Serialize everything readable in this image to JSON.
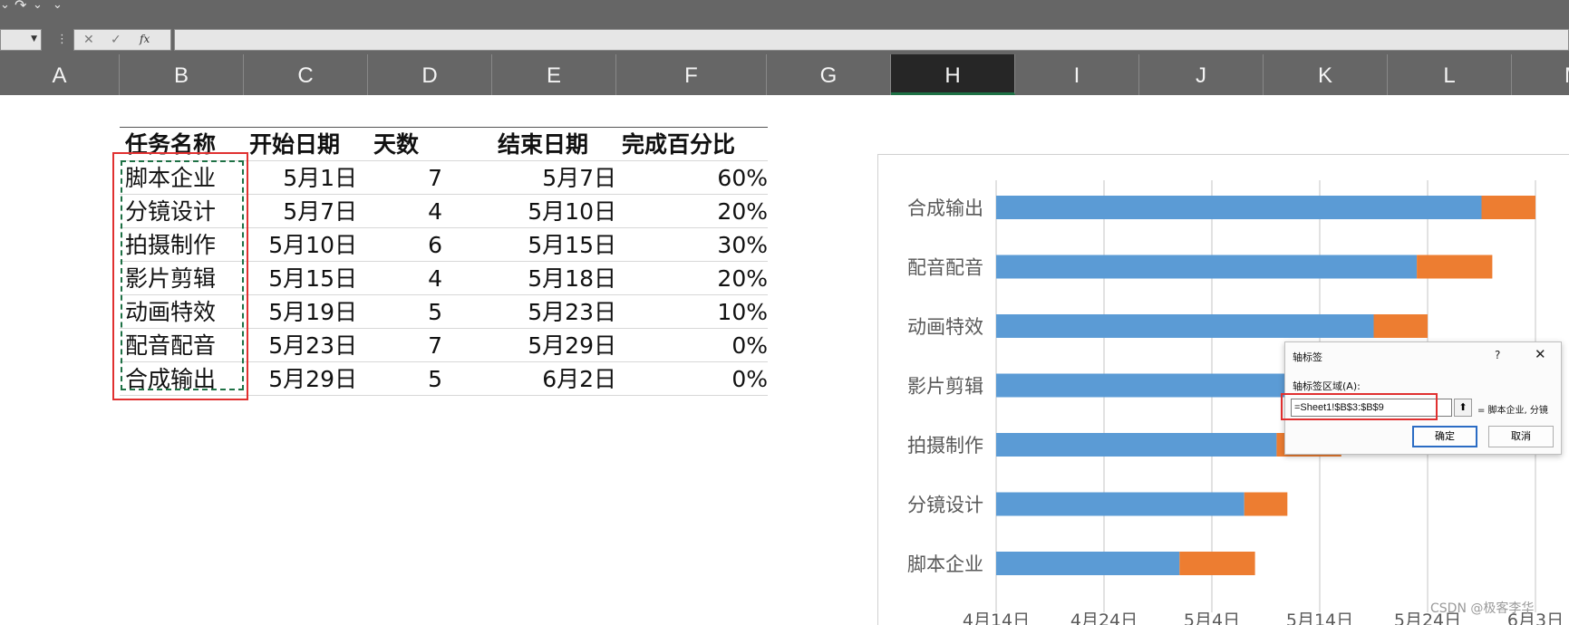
{
  "quick_access": {
    "undo_arrow": "⌄",
    "redo_icon": "↷",
    "redo_arrow": "⌄",
    "customize": "⌄"
  },
  "formula_bar": {
    "fx": "fx",
    "cancel": "✕",
    "enter": "✓",
    "content": ""
  },
  "columns": [
    {
      "label": "A",
      "selected": false
    },
    {
      "label": "B",
      "selected": false
    },
    {
      "label": "C",
      "selected": false
    },
    {
      "label": "D",
      "selected": false
    },
    {
      "label": "E",
      "selected": false
    },
    {
      "label": "F",
      "selected": false
    },
    {
      "label": "G",
      "selected": false
    },
    {
      "label": "H",
      "selected": true
    },
    {
      "label": "I",
      "selected": false
    },
    {
      "label": "J",
      "selected": false
    },
    {
      "label": "K",
      "selected": false
    },
    {
      "label": "L",
      "selected": false
    },
    {
      "label": "M",
      "selected": false
    }
  ],
  "table": {
    "headers": [
      "任务名称",
      "开始日期",
      "天数",
      "结束日期",
      "完成百分比"
    ],
    "rows": [
      [
        "脚本企业",
        "5月1日",
        "7",
        "5月7日",
        "60%"
      ],
      [
        "分镜设计",
        "5月7日",
        "4",
        "5月10日",
        "20%"
      ],
      [
        "拍摄制作",
        "5月10日",
        "6",
        "5月15日",
        "30%"
      ],
      [
        "影片剪辑",
        "5月15日",
        "4",
        "5月18日",
        "20%"
      ],
      [
        "动画特效",
        "5月19日",
        "5",
        "5月23日",
        "10%"
      ],
      [
        "配音配音",
        "5月23日",
        "7",
        "5月29日",
        "0%"
      ],
      [
        "合成输出",
        "5月29日",
        "5",
        "6月2日",
        "0%"
      ]
    ]
  },
  "chart_data": {
    "type": "bar",
    "orientation": "horizontal",
    "stacked": true,
    "categories": [
      "脚本企业",
      "分镜设计",
      "拍摄制作",
      "影片剪辑",
      "动画特效",
      "配音配音",
      "合成输出"
    ],
    "series": [
      {
        "values": [
          17,
          23,
          26,
          31,
          35,
          39,
          45
        ],
        "color": "#5b9bd5"
      },
      {
        "values": [
          7,
          4,
          6,
          4,
          5,
          7,
          5
        ],
        "color": "#ed7d31"
      }
    ],
    "xlim": [
      0,
      50
    ],
    "x_ticks": [
      0,
      10,
      20,
      30,
      40,
      50
    ],
    "x_tick_labels": [
      "4月14日",
      "4月24日",
      "5月4日",
      "5月14日",
      "5月24日",
      "6月3日"
    ],
    "grid": true
  },
  "dialog": {
    "title": "轴标签",
    "help": "?",
    "close": "✕",
    "field_label": "轴标签区域(A):",
    "field_value": "=Sheet1!$B$3:$B$9",
    "preview": "= 脚本企业, 分镜",
    "ok": "确定",
    "cancel": "取消"
  },
  "watermark": "CSDN @极客李华"
}
